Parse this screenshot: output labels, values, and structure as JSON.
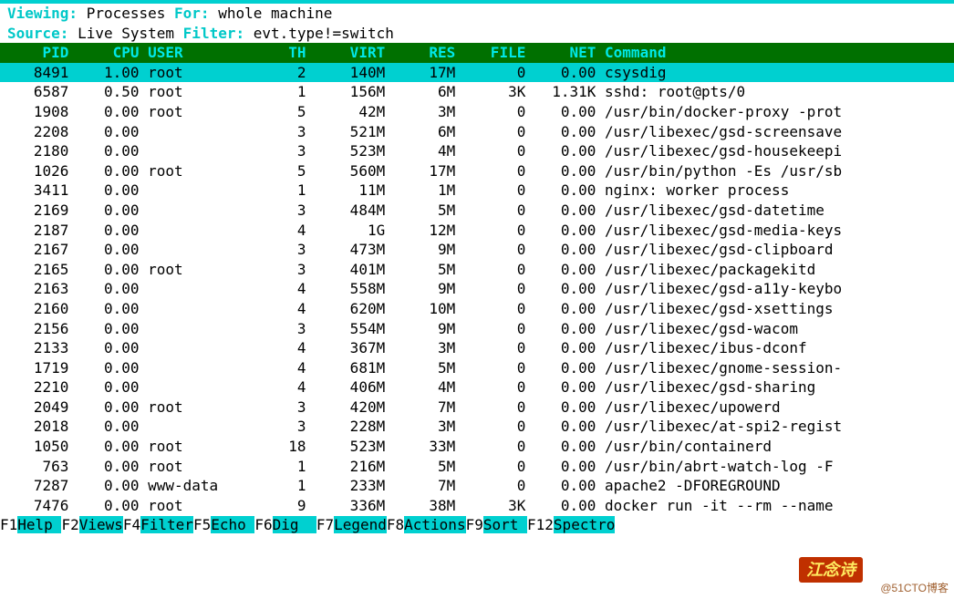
{
  "info1": {
    "label_viewing": "Viewing:",
    "value_viewing": " Processes ",
    "label_for": "For:",
    "value_for": " whole machine"
  },
  "info2": {
    "label_source": "Source:",
    "value_source": " Live System ",
    "label_filter": "Filter:",
    "value_filter": " evt.type!=switch"
  },
  "columns": [
    "PID",
    "CPU",
    "USER",
    "TH",
    "VIRT",
    "RES",
    "FILE",
    "NET",
    "Command"
  ],
  "rows": [
    {
      "pid": "8491",
      "cpu": "1.00",
      "user": "root",
      "th": "2",
      "virt": "140M",
      "res": "17M",
      "file": "0",
      "net": "0.00",
      "cmd": "csysdig",
      "sel": true
    },
    {
      "pid": "6587",
      "cpu": "0.50",
      "user": "root",
      "th": "1",
      "virt": "156M",
      "res": "6M",
      "file": "3K",
      "net": "1.31K",
      "cmd": "sshd: root@pts/0"
    },
    {
      "pid": "1908",
      "cpu": "0.00",
      "user": "root",
      "th": "5",
      "virt": "42M",
      "res": "3M",
      "file": "0",
      "net": "0.00",
      "cmd": "/usr/bin/docker-proxy -prot"
    },
    {
      "pid": "2208",
      "cpu": "0.00",
      "user": "",
      "th": "3",
      "virt": "521M",
      "res": "6M",
      "file": "0",
      "net": "0.00",
      "cmd": "/usr/libexec/gsd-screensave"
    },
    {
      "pid": "2180",
      "cpu": "0.00",
      "user": "",
      "th": "3",
      "virt": "523M",
      "res": "4M",
      "file": "0",
      "net": "0.00",
      "cmd": "/usr/libexec/gsd-housekeepi"
    },
    {
      "pid": "1026",
      "cpu": "0.00",
      "user": "root",
      "th": "5",
      "virt": "560M",
      "res": "17M",
      "file": "0",
      "net": "0.00",
      "cmd": "/usr/bin/python -Es /usr/sb"
    },
    {
      "pid": "3411",
      "cpu": "0.00",
      "user": "",
      "th": "1",
      "virt": "11M",
      "res": "1M",
      "file": "0",
      "net": "0.00",
      "cmd": "nginx: worker process"
    },
    {
      "pid": "2169",
      "cpu": "0.00",
      "user": "",
      "th": "3",
      "virt": "484M",
      "res": "5M",
      "file": "0",
      "net": "0.00",
      "cmd": "/usr/libexec/gsd-datetime"
    },
    {
      "pid": "2187",
      "cpu": "0.00",
      "user": "",
      "th": "4",
      "virt": "1G",
      "res": "12M",
      "file": "0",
      "net": "0.00",
      "cmd": "/usr/libexec/gsd-media-keys"
    },
    {
      "pid": "2167",
      "cpu": "0.00",
      "user": "",
      "th": "3",
      "virt": "473M",
      "res": "9M",
      "file": "0",
      "net": "0.00",
      "cmd": "/usr/libexec/gsd-clipboard"
    },
    {
      "pid": "2165",
      "cpu": "0.00",
      "user": "root",
      "th": "3",
      "virt": "401M",
      "res": "5M",
      "file": "0",
      "net": "0.00",
      "cmd": "/usr/libexec/packagekitd"
    },
    {
      "pid": "2163",
      "cpu": "0.00",
      "user": "",
      "th": "4",
      "virt": "558M",
      "res": "9M",
      "file": "0",
      "net": "0.00",
      "cmd": "/usr/libexec/gsd-a11y-keybo"
    },
    {
      "pid": "2160",
      "cpu": "0.00",
      "user": "",
      "th": "4",
      "virt": "620M",
      "res": "10M",
      "file": "0",
      "net": "0.00",
      "cmd": "/usr/libexec/gsd-xsettings"
    },
    {
      "pid": "2156",
      "cpu": "0.00",
      "user": "",
      "th": "3",
      "virt": "554M",
      "res": "9M",
      "file": "0",
      "net": "0.00",
      "cmd": "/usr/libexec/gsd-wacom"
    },
    {
      "pid": "2133",
      "cpu": "0.00",
      "user": "",
      "th": "4",
      "virt": "367M",
      "res": "3M",
      "file": "0",
      "net": "0.00",
      "cmd": "/usr/libexec/ibus-dconf"
    },
    {
      "pid": "1719",
      "cpu": "0.00",
      "user": "",
      "th": "4",
      "virt": "681M",
      "res": "5M",
      "file": "0",
      "net": "0.00",
      "cmd": "/usr/libexec/gnome-session-"
    },
    {
      "pid": "2210",
      "cpu": "0.00",
      "user": "",
      "th": "4",
      "virt": "406M",
      "res": "4M",
      "file": "0",
      "net": "0.00",
      "cmd": "/usr/libexec/gsd-sharing"
    },
    {
      "pid": "2049",
      "cpu": "0.00",
      "user": "root",
      "th": "3",
      "virt": "420M",
      "res": "7M",
      "file": "0",
      "net": "0.00",
      "cmd": "/usr/libexec/upowerd"
    },
    {
      "pid": "2018",
      "cpu": "0.00",
      "user": "",
      "th": "3",
      "virt": "228M",
      "res": "3M",
      "file": "0",
      "net": "0.00",
      "cmd": "/usr/libexec/at-spi2-regist"
    },
    {
      "pid": "1050",
      "cpu": "0.00",
      "user": "root",
      "th": "18",
      "virt": "523M",
      "res": "33M",
      "file": "0",
      "net": "0.00",
      "cmd": "/usr/bin/containerd"
    },
    {
      "pid": "763",
      "cpu": "0.00",
      "user": "root",
      "th": "1",
      "virt": "216M",
      "res": "5M",
      "file": "0",
      "net": "0.00",
      "cmd": "/usr/bin/abrt-watch-log -F"
    },
    {
      "pid": "7287",
      "cpu": "0.00",
      "user": "www-data",
      "th": "1",
      "virt": "233M",
      "res": "7M",
      "file": "0",
      "net": "0.00",
      "cmd": "apache2 -DFOREGROUND"
    },
    {
      "pid": "7476",
      "cpu": "0.00",
      "user": "root",
      "th": "9",
      "virt": "336M",
      "res": "38M",
      "file": "3K",
      "net": "0.00",
      "cmd": "docker run -it --rm --name"
    }
  ],
  "footer": [
    {
      "key": "F1",
      "label": "Help "
    },
    {
      "key": "F2",
      "label": "Views"
    },
    {
      "key": "F4",
      "label": "Filter"
    },
    {
      "key": "F5",
      "label": "Echo "
    },
    {
      "key": "F6",
      "label": "Dig  "
    },
    {
      "key": "F7",
      "label": "Legend"
    },
    {
      "key": "F8",
      "label": "Actions"
    },
    {
      "key": "F9",
      "label": "Sort "
    },
    {
      "key": "F12",
      "label": "Spectro"
    }
  ],
  "watermark_badge": "江念诗",
  "watermark_text": "@51CTO博客"
}
